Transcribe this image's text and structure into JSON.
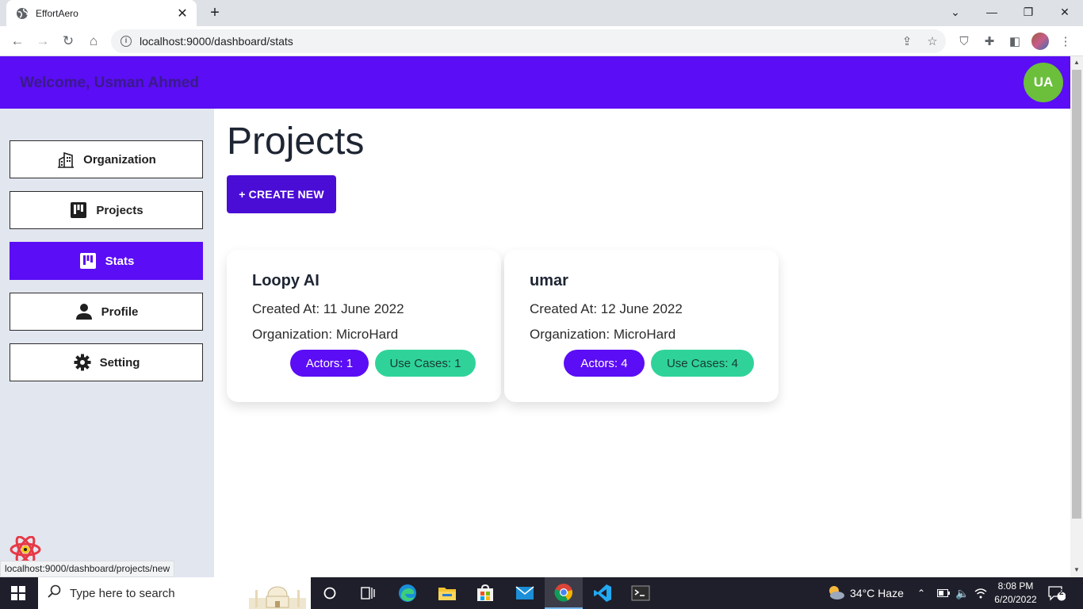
{
  "browser": {
    "tab_title": "EffortAero",
    "url": "localhost:9000/dashboard/stats",
    "status_url": "localhost:9000/dashboard/projects/new"
  },
  "header": {
    "welcome": "Welcome, Usman Ahmed",
    "avatar_initials": "UA",
    "bg_color": "#5b0df5"
  },
  "sidebar": {
    "items": [
      {
        "label": "Organization",
        "icon": "building-icon",
        "active": false
      },
      {
        "label": "Projects",
        "icon": "board-icon",
        "active": false
      },
      {
        "label": "Stats",
        "icon": "board-icon",
        "active": true
      },
      {
        "label": "Profile",
        "icon": "person-icon",
        "active": false
      },
      {
        "label": "Setting",
        "icon": "gear-icon",
        "active": false
      }
    ]
  },
  "main": {
    "title": "Projects",
    "create_label": "+ CREATE NEW",
    "projects": [
      {
        "name": "Loopy AI",
        "created": "Created At: 11 June 2022",
        "org": "Organization: MicroHard",
        "actors": "Actors: 1",
        "use_cases": "Use Cases: 1"
      },
      {
        "name": "umar",
        "created": "Created At: 12 June 2022",
        "org": "Organization: MicroHard",
        "actors": "Actors: 4",
        "use_cases": "Use Cases: 4"
      }
    ]
  },
  "taskbar": {
    "search_placeholder": "Type here to search",
    "weather": "34°C  Haze",
    "time": "8:08 PM",
    "date": "6/20/2022",
    "notifications": "2"
  }
}
